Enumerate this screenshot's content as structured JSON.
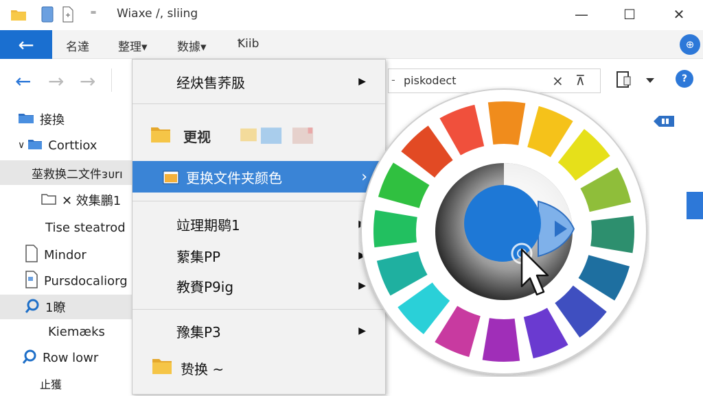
{
  "window": {
    "title": "Wiaxe /, sliing",
    "minimize": "—",
    "maximize": "☐",
    "close": "✕"
  },
  "ribbon": {
    "back": "←",
    "tabs": [
      "名達",
      "整理▾",
      "数據▾",
      "Ꝁiib"
    ],
    "help": "⊕"
  },
  "nav": {
    "back": "←",
    "forward": "→",
    "up": "→",
    "address_text": "piskodect",
    "address_prefix": "-",
    "clear": "×",
    "pin": "⊼"
  },
  "sidebar": {
    "items": [
      {
        "label": "接換",
        "icon": "folder-icon"
      },
      {
        "label": "Corttiox",
        "icon": "folder-icon",
        "prefix": "∨"
      },
      {
        "label": "莝救换二文件ᴈᴜrı",
        "icon": "",
        "selected": true
      },
      {
        "label": "✕ 效集鵬1",
        "icon": "folder-outline-icon"
      },
      {
        "label": "Tise steatrod",
        "icon": ""
      },
      {
        "label": "Mindor",
        "icon": "document-icon"
      },
      {
        "label": "Pursdocaliorg",
        "icon": "document-icon"
      },
      {
        "label": "1瞭",
        "icon": "search-icon",
        "selected": true
      },
      {
        "label": "Kiemæks",
        "icon": ""
      },
      {
        "label": "Row lowr",
        "icon": "search-icon"
      },
      {
        "label": "止獲",
        "icon": ""
      }
    ]
  },
  "menu": {
    "items": [
      {
        "label": "经炔售荞䏜",
        "arrow": "▶"
      },
      {
        "label": "更视",
        "folders": true
      },
      {
        "label": "更换文件夹颜色",
        "arrow": "›",
        "highlighted": true
      },
      {
        "label": "竝理期鹖1",
        "arrow": "▶"
      },
      {
        "label": "蕠集PP",
        "arrow": "▶"
      },
      {
        "label": "教賚P9ig",
        "arrow": "▶"
      },
      {
        "label": "豫集P3",
        "arrow": "▶"
      },
      {
        "label": "贽换 ~"
      }
    ]
  },
  "colors": {
    "accent": "#1a6fd0",
    "highlight": "#3a84d6",
    "selected_color": "#1e78d6"
  }
}
